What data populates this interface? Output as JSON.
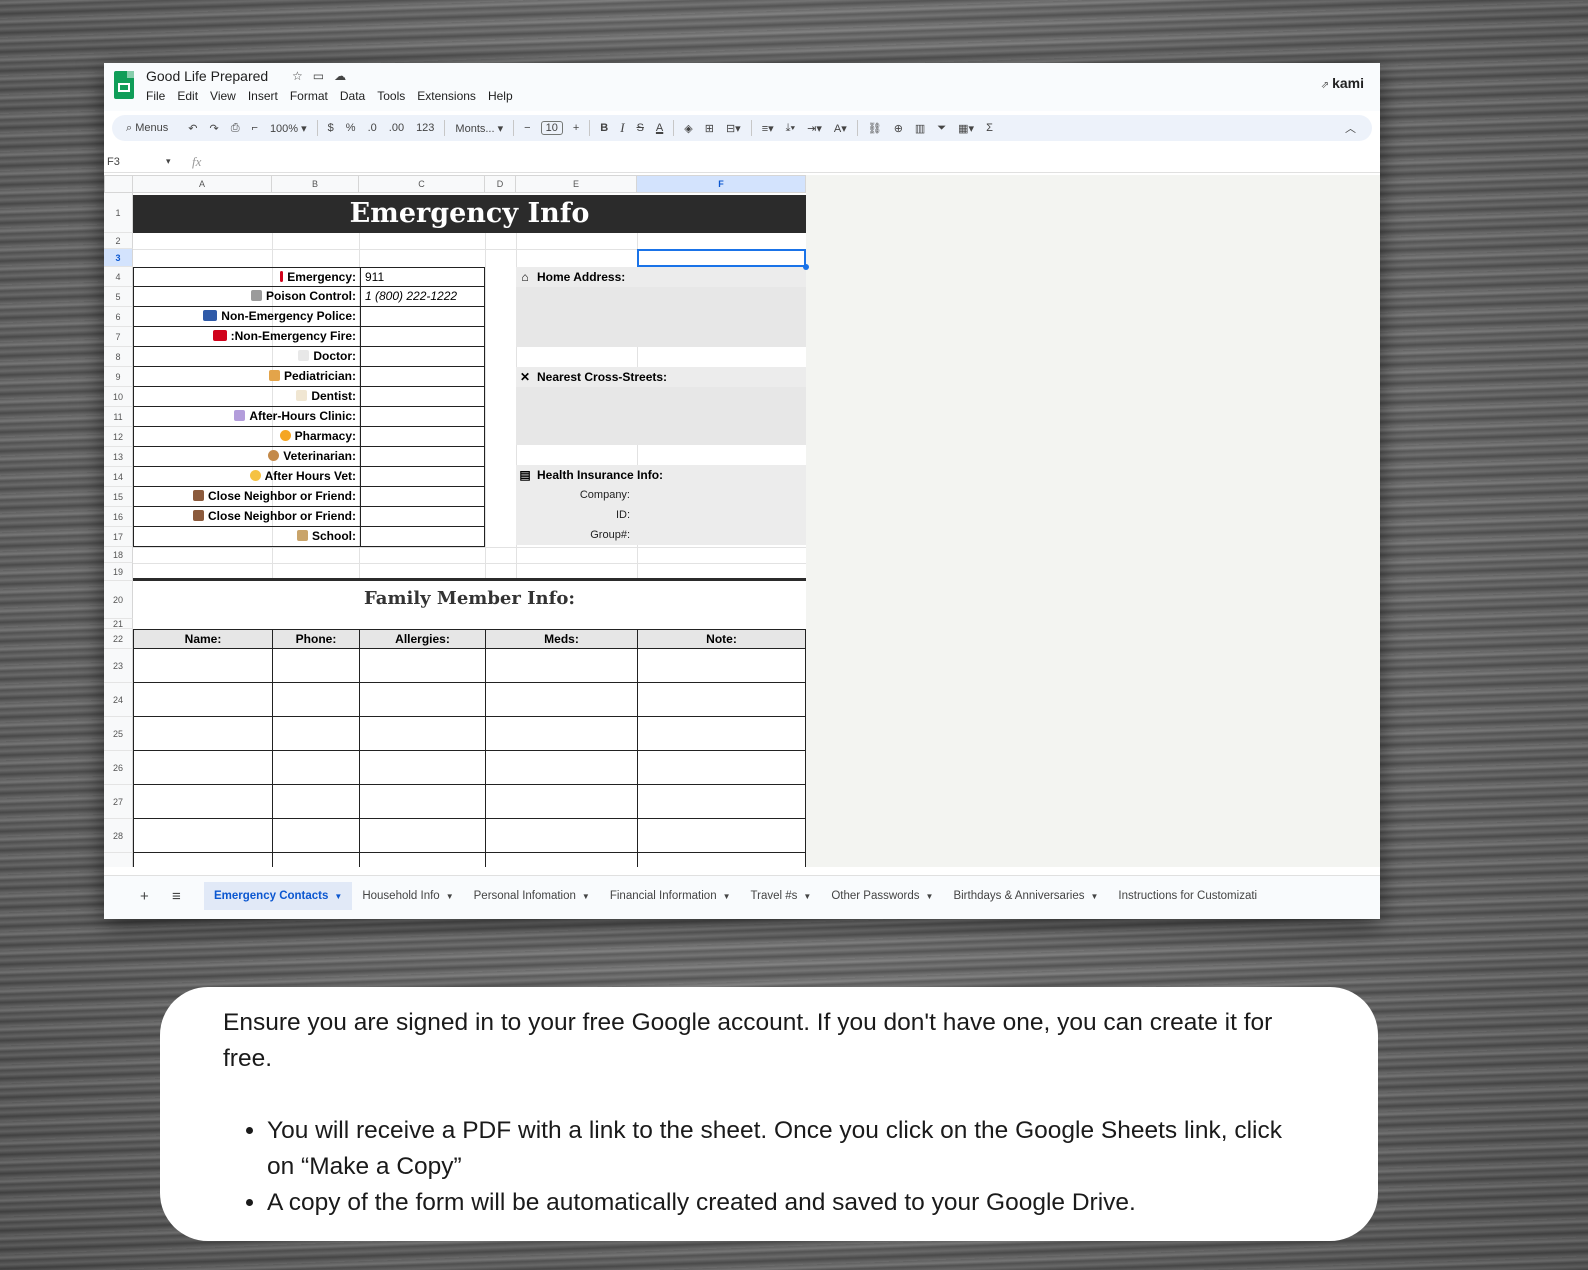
{
  "app": {
    "doc_title": "Good Life Prepared",
    "menus": [
      "File",
      "Edit",
      "View",
      "Insert",
      "Format",
      "Data",
      "Tools",
      "Extensions",
      "Help"
    ],
    "extension_label": "kami"
  },
  "toolbar": {
    "search_label": "Menus",
    "zoom": "100%",
    "currency": "$",
    "percent": "%",
    "dec_less": ".0",
    "dec_more": ".00",
    "number_format": "123",
    "font": "Monts...",
    "font_size": "10",
    "minus": "−",
    "plus": "+",
    "bold": "B",
    "italic": "I",
    "strike": "S",
    "text_color": "A",
    "sum": "Σ"
  },
  "formula_bar": {
    "cell_ref": "F3",
    "fx": "fx"
  },
  "columns": [
    "A",
    "B",
    "C",
    "D",
    "E",
    "F"
  ],
  "rows": [
    "1",
    "2",
    "3",
    "4",
    "5",
    "6",
    "7",
    "8",
    "9",
    "10",
    "11",
    "12",
    "13",
    "14",
    "15",
    "16",
    "17",
    "18",
    "19",
    "20",
    "21",
    "22",
    "23",
    "24",
    "25",
    "26",
    "27",
    "28"
  ],
  "sheet": {
    "banner": "Emergency Info",
    "contacts": [
      {
        "label": "Emergency:",
        "value": "911",
        "emoji_color": "#d0021b"
      },
      {
        "label": "Poison Control:",
        "value": "1 (800) 222-1222",
        "emoji_color": "#9b9b9b"
      },
      {
        "label": "Non-Emergency Police:",
        "value": "",
        "emoji_color": "#2f5aa8"
      },
      {
        "label": ":Non-Emergency Fire:",
        "value": "",
        "emoji_color": "#d0021b"
      },
      {
        "label": "Doctor:",
        "value": "",
        "emoji_color": "#e8e8e8"
      },
      {
        "label": "Pediatrician:",
        "value": "",
        "emoji_color": "#e3a44a"
      },
      {
        "label": "Dentist:",
        "value": "",
        "emoji_color": "#f0e6d2"
      },
      {
        "label": "After-Hours Clinic:",
        "value": "",
        "emoji_color": "#b39ddb"
      },
      {
        "label": "Pharmacy:",
        "value": "",
        "emoji_color": "#f5a623"
      },
      {
        "label": "Veterinarian:",
        "value": "",
        "emoji_color": "#c48a4a"
      },
      {
        "label": "After Hours Vet:",
        "value": "",
        "emoji_color": "#f5c242"
      },
      {
        "label": "Close Neighbor or Friend:",
        "value": "",
        "emoji_color": "#8b5a3c"
      },
      {
        "label": "Close Neighbor or Friend:",
        "value": "",
        "emoji_color": "#8b5a3c"
      },
      {
        "label": "School:",
        "value": "",
        "emoji_color": "#c9a46a"
      }
    ],
    "home_address": "Home Address:",
    "cross_streets": "Nearest Cross-Streets:",
    "insurance": "Health Insurance Info:",
    "insurance_fields": [
      "Company:",
      "ID:",
      "Group#:"
    ],
    "family_title": "Family Member Info:",
    "family_columns": [
      "Name:",
      "Phone:",
      "Allergies:",
      "Meds:",
      "Note:"
    ]
  },
  "tabs": [
    "Emergency Contacts",
    "Household Info",
    "Personal Infomation",
    "Financial Information",
    "Travel #s",
    "Other Passwords",
    "Birthdays & Anniversaries",
    "Instructions for Customizati"
  ],
  "card": {
    "intro": "Ensure you are signed in to your free Google account. If you don't have one, you can create it for free.",
    "bullets": [
      "You will receive a PDF with a link to the sheet. Once you click on the Google Sheets link, click on “Make a Copy”",
      "A copy of the form will be automatically created and saved to your Google Drive."
    ]
  },
  "colors": {
    "accent": "#0b57d0",
    "banner": "#2b2b2b",
    "sheets_green": "#0f9d58"
  }
}
